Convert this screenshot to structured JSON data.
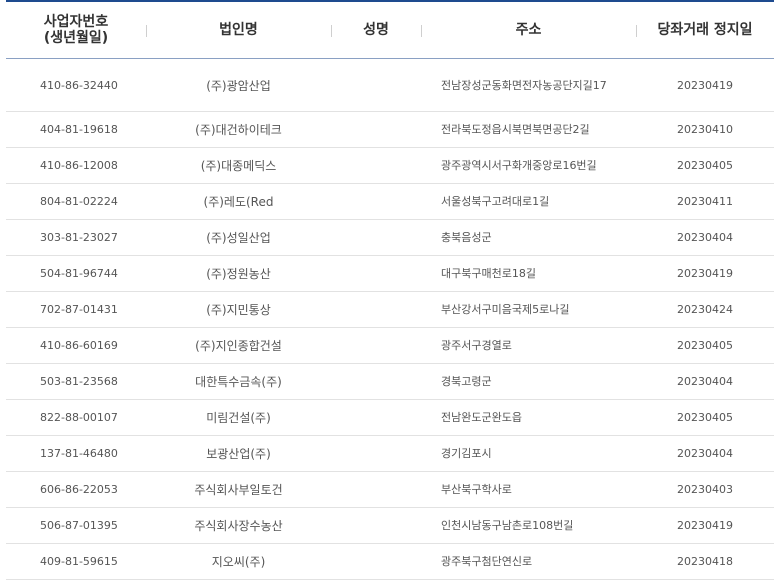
{
  "header": {
    "col_bizno": "사업자번호\n(생년월일)",
    "col_bizno_line1": "사업자번호",
    "col_bizno_line2": "(생년월일)",
    "col_corp": "법인명",
    "col_name": "성명",
    "col_addr": "주소",
    "col_date": "당좌거래 정지일"
  },
  "rows": [
    {
      "bizno": "410-86-32440",
      "corp": "(주)광암산업",
      "name": "",
      "addr": "전남장성군동화면전자농공단지길17",
      "date": "20230419"
    },
    {
      "bizno": "404-81-19618",
      "corp": "(주)대건하이테크",
      "name": "",
      "addr": "전라북도정읍시북면북면공단2길",
      "date": "20230410"
    },
    {
      "bizno": "410-86-12008",
      "corp": "(주)대종메딕스",
      "name": "",
      "addr": "광주광역시서구화개중앙로16번길",
      "date": "20230405"
    },
    {
      "bizno": "804-81-02224",
      "corp": "(주)레도(Red",
      "name": "",
      "addr": "서울성북구고려대로1길",
      "date": "20230411"
    },
    {
      "bizno": "303-81-23027",
      "corp": "(주)성일산업",
      "name": "",
      "addr": "충북음성군",
      "date": "20230404"
    },
    {
      "bizno": "504-81-96744",
      "corp": "(주)정원농산",
      "name": "",
      "addr": "대구북구매천로18길",
      "date": "20230419"
    },
    {
      "bizno": "702-87-01431",
      "corp": "(주)지민통상",
      "name": "",
      "addr": "부산강서구미음국제5로나길",
      "date": "20230424"
    },
    {
      "bizno": "410-86-60169",
      "corp": "(주)지인종합건설",
      "name": "",
      "addr": "광주서구경열로",
      "date": "20230405"
    },
    {
      "bizno": "503-81-23568",
      "corp": "대한특수금속(주)",
      "name": "",
      "addr": "경북고령군",
      "date": "20230404"
    },
    {
      "bizno": "822-88-00107",
      "corp": "미림건설(주)",
      "name": "",
      "addr": "전남완도군완도읍",
      "date": "20230405"
    },
    {
      "bizno": "137-81-46480",
      "corp": "보광산업(주)",
      "name": "",
      "addr": "경기김포시",
      "date": "20230404"
    },
    {
      "bizno": "606-86-22053",
      "corp": "주식회사부일토건",
      "name": "",
      "addr": "부산북구학사로",
      "date": "20230403"
    },
    {
      "bizno": "506-87-01395",
      "corp": "주식회사장수농산",
      "name": "",
      "addr": "인천시남동구남촌로108번길",
      "date": "20230419"
    },
    {
      "bizno": "409-81-59615",
      "corp": "지오씨(주)",
      "name": "",
      "addr": "광주북구첨단연신로",
      "date": "20230418"
    }
  ]
}
